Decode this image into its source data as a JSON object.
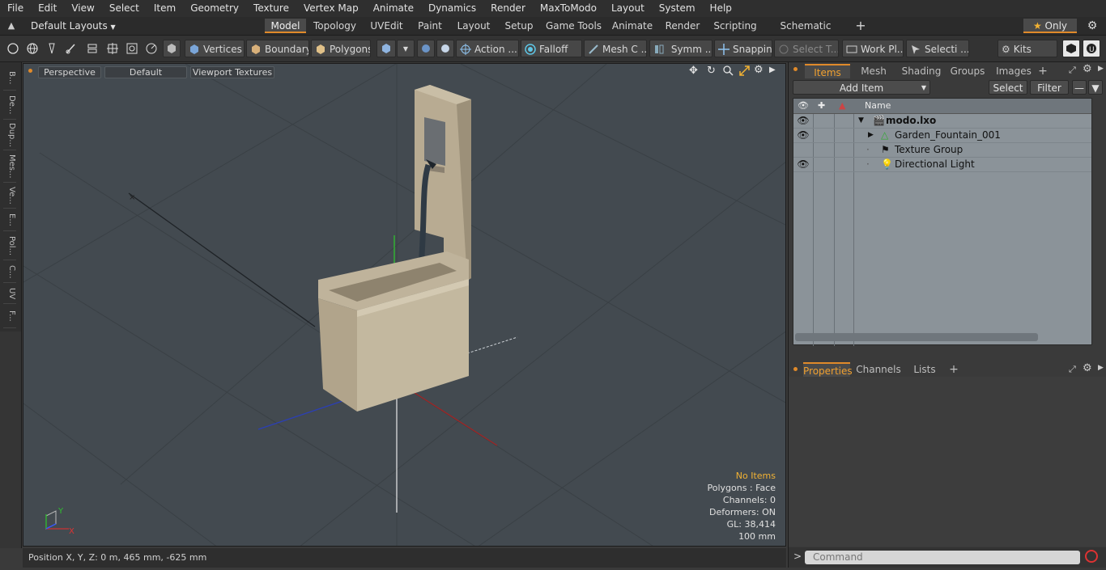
{
  "menu": [
    "File",
    "Edit",
    "View",
    "Select",
    "Item",
    "Geometry",
    "Texture",
    "Vertex Map",
    "Animate",
    "Dynamics",
    "Render",
    "MaxToModo",
    "Layout",
    "System",
    "Help"
  ],
  "layout_bar": {
    "layouts_label": "Default Layouts",
    "tabs": [
      "Model",
      "Topology",
      "UVEdit",
      "Paint",
      "Layout",
      "Setup",
      "Game Tools",
      "Animate",
      "Render",
      "Scripting",
      "Schematic Fusion"
    ],
    "active_tab": "Model",
    "add_tab": "+",
    "only_label": "Only"
  },
  "toolbar": {
    "vertices": "Vertices",
    "boundary": "Boundary",
    "polygons": "Polygons",
    "action": "Action",
    "action_more": "...",
    "falloff": "Falloff",
    "mesh_c": "Mesh C ...",
    "symm": "Symm ...",
    "snapping": "Snapping",
    "select_t": "Select T...",
    "work_pl": "Work Pl...",
    "selecti": "Selecti ...",
    "kits": "Kits"
  },
  "left_tabs": [
    "B...",
    "De...",
    "Dup...",
    "Mes...",
    "Ve...",
    "E...",
    "Pol...",
    "C...",
    "UV",
    "F..."
  ],
  "viewport": {
    "perspective": "Perspective",
    "default": "Default",
    "viewport_textures": "Viewport Textures",
    "info": {
      "no_items": "No Items",
      "polygons": "Polygons : Face",
      "channels": "Channels: 0",
      "deformers": "Deformers: ON",
      "gl": "GL: 38,414",
      "scale": "100 mm"
    },
    "axis": {
      "y": "Y",
      "x": "X"
    }
  },
  "status": {
    "position": "Position X, Y, Z:   0 m, 465 mm, -625 mm"
  },
  "items_panel": {
    "tabs": [
      "Items",
      "Mesh Ops",
      "Shading",
      "Groups",
      "Images"
    ],
    "active_tab": "Items",
    "add_tab": "+",
    "add_item": "Add Item",
    "select": "Select",
    "filter": "Filter",
    "name_col": "Name",
    "rows": [
      {
        "label": "modo.lxo",
        "bold": true
      },
      {
        "label": "Garden_Fountain_001",
        "bold": false
      },
      {
        "label": "Texture Group",
        "bold": false
      },
      {
        "label": "Directional Light",
        "bold": false
      }
    ]
  },
  "properties_panel": {
    "tabs": [
      "Properties",
      "Channels",
      "Lists"
    ],
    "active_tab": "Properties",
    "add_tab": "+"
  },
  "command": {
    "placeholder": "Command",
    "prompt": ">"
  },
  "colors": {
    "accent": "#e08a2a",
    "viewport_bg": "#434a50",
    "tree_bg": "#8b9399",
    "info_highlight": "#f2b233"
  }
}
